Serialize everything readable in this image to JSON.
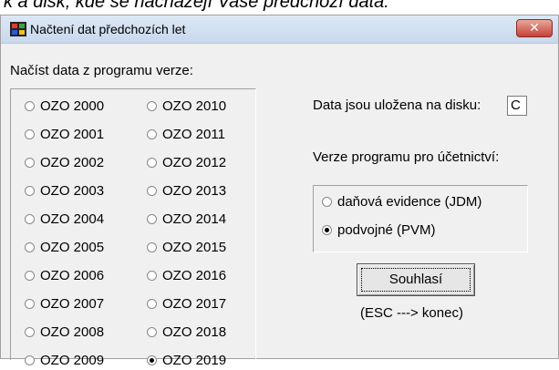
{
  "top_caption": "k a disk, kde se nacházejí Vaše předchozí data:",
  "window": {
    "title": "Načtení dat předchozích let",
    "close_glyph": "✕"
  },
  "left_group": {
    "label": "Načíst data z programu verze:",
    "options": [
      "OZO 2000",
      "OZO 2001",
      "OZO 2002",
      "OZO 2003",
      "OZO 2004",
      "OZO 2005",
      "OZO 2006",
      "OZO 2007",
      "OZO 2008",
      "OZO 2009",
      "OZO 2010",
      "OZO 2011",
      "OZO 2012",
      "OZO 2013",
      "OZO 2014",
      "OZO 2015",
      "OZO 2016",
      "OZO 2017",
      "OZO 2018",
      "OZO 2019"
    ],
    "selected": "OZO 2019"
  },
  "disk": {
    "label": "Data jsou uložena na disku:",
    "value": "C"
  },
  "program_group": {
    "label": "Verze programu pro účetnictví:",
    "options": [
      "daňová evidence (JDM)",
      "podvojné (PVM)"
    ],
    "selected": "podvojné (PVM)"
  },
  "buttons": {
    "ok_label": "Souhlasí",
    "escape_hint": "(ESC ---> konec)"
  },
  "icons": {
    "app": "windows-flag-icon",
    "close": "close-icon"
  }
}
